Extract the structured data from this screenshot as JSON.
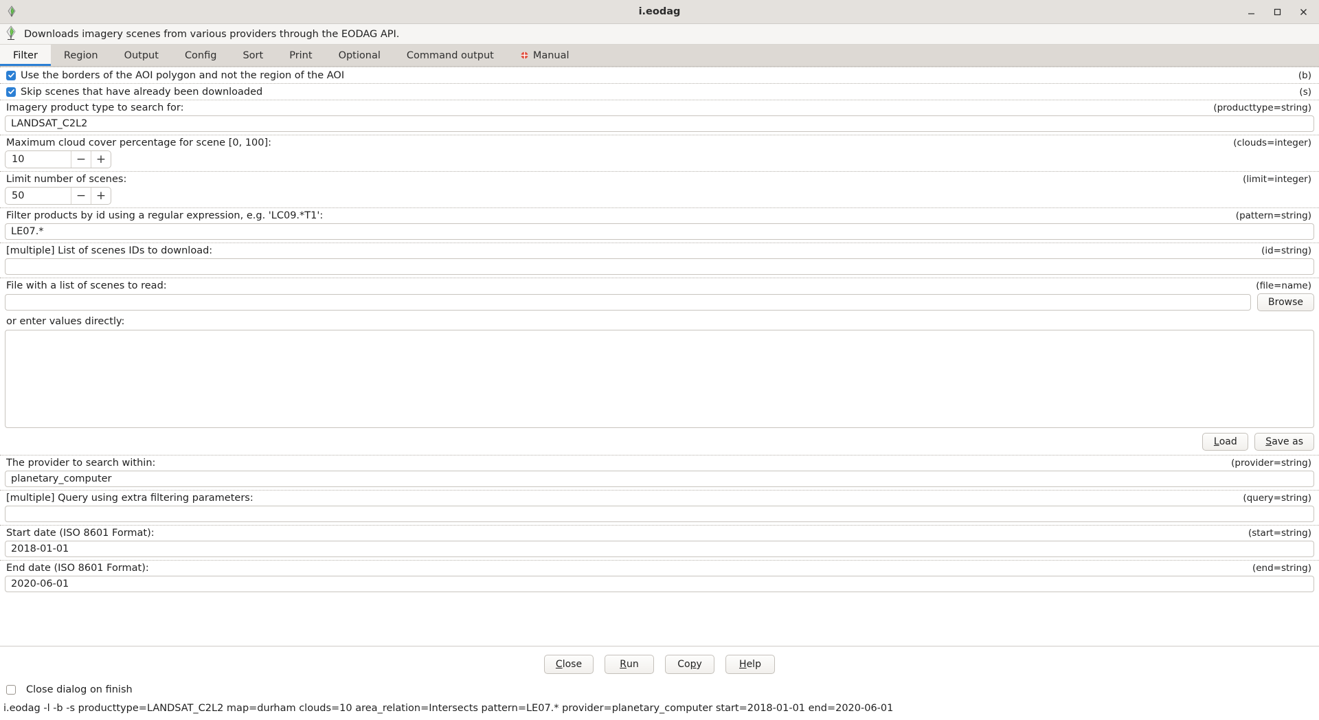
{
  "window": {
    "title": "i.eodag",
    "icon": "grass-leaf-icon",
    "controls": {
      "minimize": "minimize-icon",
      "maximize": "maximize-icon",
      "close": "close-icon"
    }
  },
  "description": {
    "icon": "grass-leaf-icon",
    "text": "Downloads imagery scenes from various providers through the EODAG API."
  },
  "tabs": [
    {
      "label": "Filter",
      "active": true
    },
    {
      "label": "Region",
      "active": false
    },
    {
      "label": "Output",
      "active": false
    },
    {
      "label": "Config",
      "active": false
    },
    {
      "label": "Sort",
      "active": false
    },
    {
      "label": "Print",
      "active": false
    },
    {
      "label": "Optional",
      "active": false
    },
    {
      "label": "Command output",
      "active": false
    },
    {
      "label": "Manual",
      "active": false,
      "icon": "manual-book-icon"
    }
  ],
  "filter": {
    "borders_checkbox": {
      "label": "Use the borders of the AOI polygon and not the region of the AOI",
      "checked": true,
      "hint": "(b)"
    },
    "skip_checkbox": {
      "label": "Skip scenes that have already been downloaded",
      "checked": true,
      "hint": "(s)"
    },
    "producttype": {
      "label": "Imagery product type to search for:",
      "hint": "(producttype=string)",
      "value": "LANDSAT_C2L2"
    },
    "clouds": {
      "label": "Maximum cloud cover percentage for scene [0, 100]:",
      "hint": "(clouds=integer)",
      "value": "10",
      "minus": "−",
      "plus": "+"
    },
    "limit": {
      "label": "Limit number of scenes:",
      "hint": "(limit=integer)",
      "value": "50",
      "minus": "−",
      "plus": "+"
    },
    "pattern": {
      "label": "Filter products by id using a regular expression, e.g. 'LC09.*T1':",
      "hint": "(pattern=string)",
      "value": "LE07.*"
    },
    "id": {
      "label": "[multiple] List of scenes IDs to download:",
      "hint": "(id=string)",
      "value": ""
    },
    "file": {
      "label": "File with a list of scenes to read:",
      "hint": "(file=name)",
      "value": "",
      "browse_label": "Browse"
    },
    "direct_values": {
      "label": "or enter values directly:",
      "value": "",
      "load_label": "Load",
      "save_label": "Save as"
    },
    "provider": {
      "label": "The provider to search within:",
      "hint": "(provider=string)",
      "value": "planetary_computer"
    },
    "query": {
      "label": "[multiple] Query using extra filtering parameters:",
      "hint": "(query=string)",
      "value": ""
    },
    "start": {
      "label": "Start date (ISO 8601 Format):",
      "hint": "(start=string)",
      "value": "2018-01-01"
    },
    "end": {
      "label": "End date (ISO 8601 Format):",
      "hint": "(end=string)",
      "value": "2020-06-01"
    }
  },
  "footer": {
    "buttons": [
      {
        "label": "Close",
        "accesskey": "C"
      },
      {
        "label": "Run",
        "accesskey": "R"
      },
      {
        "label": "Copy",
        "accesskey": "p"
      },
      {
        "label": "Help",
        "accesskey": "H"
      }
    ],
    "close_on_finish": {
      "label": "Close dialog on finish",
      "checked": false
    },
    "command": "i.eodag -l -b -s producttype=LANDSAT_C2L2 map=durham clouds=10 area_relation=Intersects pattern=LE07.* provider=planetary_computer start=2018-01-01 end=2020-06-01"
  },
  "colors": {
    "accent": "#2b7fd4",
    "titlebar_bg": "#e4e1dd",
    "tabbar_bg": "#ddd9d4"
  }
}
